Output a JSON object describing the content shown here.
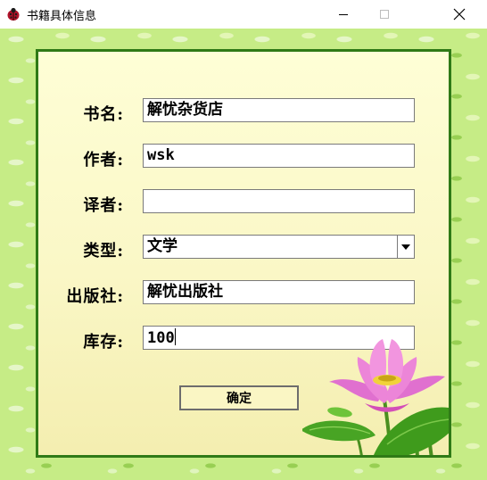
{
  "window": {
    "title": "书籍具体信息",
    "icons": [
      "ladybug-icon",
      "minimize-icon",
      "maximize-icon",
      "close-icon"
    ]
  },
  "form": {
    "book_name_label": "书名:",
    "book_name_value": "解忧杂货店",
    "author_label": "作者:",
    "author_value": "wsk",
    "translator_label": "译者:",
    "translator_value": "",
    "type_label": "类型:",
    "type_value": "文学",
    "publisher_label": "出版社:",
    "publisher_value": "解忧出版社",
    "stock_label": "库存:",
    "stock_value": "100",
    "confirm_label": "确定"
  },
  "colors": {
    "background_pattern": "#c6ec86",
    "card_border": "#2f7a16",
    "card_fill": "#fefed6",
    "lotus_petal": "#e85fc8",
    "lotus_leaf": "#3f9b1c"
  }
}
